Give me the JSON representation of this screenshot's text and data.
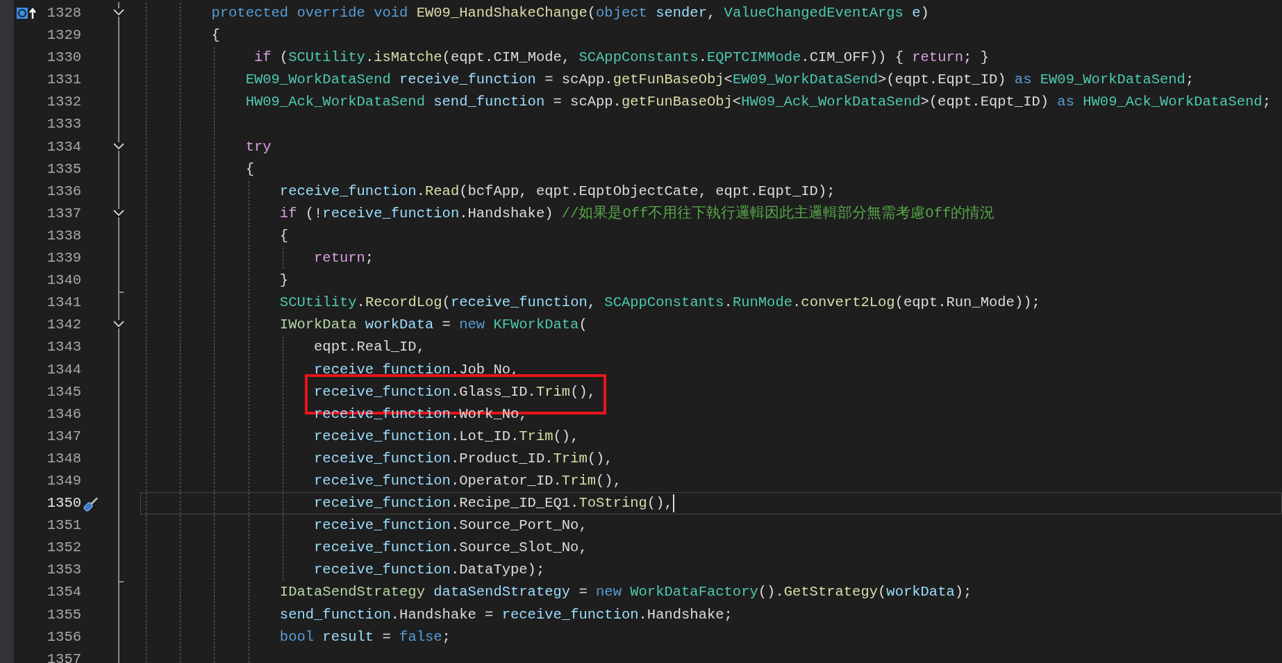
{
  "lines": [
    {
      "number": "1328",
      "collapsible": true,
      "block_end": false,
      "current": false,
      "highlighted": false,
      "glyph": {
        "kind": "override"
      },
      "code": [
        {
          "kind": "keyword",
          "text": "        protected override void "
        },
        {
          "kind": "method",
          "text": "EW09_HandShakeChange"
        },
        {
          "kind": "plain",
          "text": "("
        },
        {
          "kind": "keyword",
          "text": "object"
        },
        {
          "kind": "local",
          "text": " sender"
        },
        {
          "kind": "plain",
          "text": ", "
        },
        {
          "kind": "type",
          "text": "ValueChangedEventArgs"
        },
        {
          "kind": "local",
          "text": " e"
        },
        {
          "kind": "plain",
          "text": ")"
        }
      ]
    },
    {
      "number": "1329",
      "collapsible": false,
      "block_end": false,
      "current": false,
      "highlighted": false,
      "code": [
        {
          "kind": "plain",
          "text": "        {"
        }
      ]
    },
    {
      "number": "1330",
      "collapsible": false,
      "block_end": false,
      "current": false,
      "highlighted": false,
      "code": [
        {
          "kind": "control",
          "text": "             if"
        },
        {
          "kind": "plain",
          "text": " ("
        },
        {
          "kind": "type",
          "text": "SCUtility"
        },
        {
          "kind": "plain",
          "text": "."
        },
        {
          "kind": "method",
          "text": "isMatche"
        },
        {
          "kind": "plain",
          "text": "(eqpt.CIM_Mode, "
        },
        {
          "kind": "type",
          "text": "SCAppConstants"
        },
        {
          "kind": "plain",
          "text": "."
        },
        {
          "kind": "type",
          "text": "EQPTCIMMode"
        },
        {
          "kind": "plain",
          "text": ".CIM_OFF)) { "
        },
        {
          "kind": "control",
          "text": "return"
        },
        {
          "kind": "plain",
          "text": "; }"
        }
      ]
    },
    {
      "number": "1331",
      "collapsible": false,
      "block_end": false,
      "current": false,
      "highlighted": false,
      "code": [
        {
          "kind": "type",
          "text": "            EW09_WorkDataSend"
        },
        {
          "kind": "local",
          "text": " receive_function"
        },
        {
          "kind": "plain",
          "text": " = scApp."
        },
        {
          "kind": "method",
          "text": "getFunBaseObj"
        },
        {
          "kind": "plain",
          "text": "<"
        },
        {
          "kind": "type",
          "text": "EW09_WorkDataSend"
        },
        {
          "kind": "plain",
          "text": ">(eqpt.Eqpt_ID) "
        },
        {
          "kind": "keyword",
          "text": "as"
        },
        {
          "kind": "type",
          "text": " EW09_WorkDataSend"
        },
        {
          "kind": "plain",
          "text": ";"
        }
      ]
    },
    {
      "number": "1332",
      "collapsible": false,
      "block_end": false,
      "current": false,
      "highlighted": false,
      "code": [
        {
          "kind": "type",
          "text": "            HW09_Ack_WorkDataSend"
        },
        {
          "kind": "local",
          "text": " send_function"
        },
        {
          "kind": "plain",
          "text": " = scApp."
        },
        {
          "kind": "method",
          "text": "getFunBaseObj"
        },
        {
          "kind": "plain",
          "text": "<"
        },
        {
          "kind": "type",
          "text": "HW09_Ack_WorkDataSend"
        },
        {
          "kind": "plain",
          "text": ">(eqpt.Eqpt_ID) "
        },
        {
          "kind": "keyword",
          "text": "as"
        },
        {
          "kind": "type",
          "text": " HW09_Ack_WorkDataSend"
        },
        {
          "kind": "plain",
          "text": ";"
        }
      ]
    },
    {
      "number": "1333",
      "collapsible": false,
      "block_end": false,
      "current": false,
      "highlighted": false
    },
    {
      "number": "1334",
      "collapsible": true,
      "block_end": false,
      "current": false,
      "highlighted": false,
      "code": [
        {
          "kind": "control",
          "text": "            try"
        }
      ]
    },
    {
      "number": "1335",
      "collapsible": false,
      "block_end": false,
      "current": false,
      "highlighted": false,
      "code": [
        {
          "kind": "plain",
          "text": "            {"
        }
      ]
    },
    {
      "number": "1336",
      "collapsible": false,
      "block_end": false,
      "current": false,
      "highlighted": false,
      "code": [
        {
          "kind": "local",
          "text": "                receive_function"
        },
        {
          "kind": "plain",
          "text": "."
        },
        {
          "kind": "method",
          "text": "Read"
        },
        {
          "kind": "plain",
          "text": "(bcfApp, eqpt.EqptObjectCate, eqpt.Eqpt_ID);"
        }
      ]
    },
    {
      "number": "1337",
      "collapsible": true,
      "block_end": false,
      "current": false,
      "highlighted": false,
      "code": [
        {
          "kind": "control",
          "text": "                if"
        },
        {
          "kind": "plain",
          "text": " (!"
        },
        {
          "kind": "local",
          "text": "receive_function"
        },
        {
          "kind": "plain",
          "text": ".Handshake) "
        },
        {
          "kind": "comment",
          "text": "//如果是Off不用往下執行邏輯因此主邏輯部分無需考慮Off的情況"
        }
      ]
    },
    {
      "number": "1338",
      "collapsible": false,
      "block_end": false,
      "current": false,
      "highlighted": false,
      "code": [
        {
          "kind": "plain",
          "text": "                {"
        }
      ]
    },
    {
      "number": "1339",
      "collapsible": false,
      "block_end": false,
      "current": false,
      "highlighted": false,
      "code": [
        {
          "kind": "control",
          "text": "                    return"
        },
        {
          "kind": "plain",
          "text": ";"
        }
      ]
    },
    {
      "number": "1340",
      "collapsible": false,
      "block_end": false,
      "current": false,
      "highlighted": false,
      "code": [
        {
          "kind": "plain",
          "text": "                }"
        }
      ]
    },
    {
      "number": "1341",
      "collapsible": false,
      "block_end": true,
      "current": false,
      "highlighted": false,
      "code": [
        {
          "kind": "type",
          "text": "                SCUtility"
        },
        {
          "kind": "plain",
          "text": "."
        },
        {
          "kind": "method",
          "text": "RecordLog"
        },
        {
          "kind": "plain",
          "text": "("
        },
        {
          "kind": "local",
          "text": "receive_function"
        },
        {
          "kind": "plain",
          "text": ", "
        },
        {
          "kind": "type",
          "text": "SCAppConstants"
        },
        {
          "kind": "plain",
          "text": "."
        },
        {
          "kind": "type",
          "text": "RunMode"
        },
        {
          "kind": "plain",
          "text": "."
        },
        {
          "kind": "method",
          "text": "convert2Log"
        },
        {
          "kind": "plain",
          "text": "(eqpt.Run_Mode));"
        }
      ]
    },
    {
      "number": "1342",
      "collapsible": true,
      "block_end": false,
      "current": false,
      "highlighted": false,
      "code": [
        {
          "kind": "interface",
          "text": "                IWorkData"
        },
        {
          "kind": "local",
          "text": " workData"
        },
        {
          "kind": "plain",
          "text": " = "
        },
        {
          "kind": "keyword",
          "text": "new"
        },
        {
          "kind": "type",
          "text": " KFWorkData"
        },
        {
          "kind": "plain",
          "text": "("
        }
      ]
    },
    {
      "number": "1343",
      "collapsible": false,
      "block_end": false,
      "current": false,
      "highlighted": false,
      "code": [
        {
          "kind": "plain",
          "text": "                    eqpt.Real_ID,"
        }
      ]
    },
    {
      "number": "1344",
      "collapsible": false,
      "block_end": false,
      "current": false,
      "highlighted": false,
      "code": [
        {
          "kind": "local",
          "text": "                    receive_function"
        },
        {
          "kind": "plain",
          "text": ".Job_No,"
        }
      ]
    },
    {
      "number": "1345",
      "collapsible": false,
      "block_end": false,
      "current": false,
      "highlighted": true,
      "code": [
        {
          "kind": "local",
          "text": "                    receive_function"
        },
        {
          "kind": "plain",
          "text": ".Glass_ID."
        },
        {
          "kind": "method",
          "text": "Trim"
        },
        {
          "kind": "plain",
          "text": "(),"
        }
      ]
    },
    {
      "number": "1346",
      "collapsible": false,
      "block_end": false,
      "current": false,
      "highlighted": false,
      "code": [
        {
          "kind": "local",
          "text": "                    receive_function"
        },
        {
          "kind": "plain",
          "text": ".Work_No,"
        }
      ]
    },
    {
      "number": "1347",
      "collapsible": false,
      "block_end": false,
      "current": false,
      "highlighted": false,
      "code": [
        {
          "kind": "local",
          "text": "                    receive_function"
        },
        {
          "kind": "plain",
          "text": ".Lot_ID."
        },
        {
          "kind": "method",
          "text": "Trim"
        },
        {
          "kind": "plain",
          "text": "(),"
        }
      ]
    },
    {
      "number": "1348",
      "collapsible": false,
      "block_end": false,
      "current": false,
      "highlighted": false,
      "code": [
        {
          "kind": "local",
          "text": "                    receive_function"
        },
        {
          "kind": "plain",
          "text": ".Product_ID."
        },
        {
          "kind": "method",
          "text": "Trim"
        },
        {
          "kind": "plain",
          "text": "(),"
        }
      ]
    },
    {
      "number": "1349",
      "collapsible": false,
      "block_end": false,
      "current": false,
      "highlighted": false,
      "code": [
        {
          "kind": "local",
          "text": "                    receive_function"
        },
        {
          "kind": "plain",
          "text": ".Operator_ID."
        },
        {
          "kind": "method",
          "text": "Trim"
        },
        {
          "kind": "plain",
          "text": "(),"
        }
      ]
    },
    {
      "number": "1350",
      "collapsible": false,
      "block_end": false,
      "current": true,
      "highlighted": false,
      "glyph": {
        "kind": "quick-action"
      },
      "code": [
        {
          "kind": "local",
          "text": "                    receive_function"
        },
        {
          "kind": "plain",
          "text": ".Recipe_ID_EQ1."
        },
        {
          "kind": "method",
          "text": "ToString"
        },
        {
          "kind": "plain",
          "text": "(),"
        }
      ]
    },
    {
      "number": "1351",
      "collapsible": false,
      "block_end": false,
      "current": false,
      "highlighted": false,
      "code": [
        {
          "kind": "local",
          "text": "                    receive_function"
        },
        {
          "kind": "plain",
          "text": ".Source_Port_No,"
        }
      ]
    },
    {
      "number": "1352",
      "collapsible": false,
      "block_end": false,
      "current": false,
      "highlighted": false,
      "code": [
        {
          "kind": "local",
          "text": "                    receive_function"
        },
        {
          "kind": "plain",
          "text": ".Source_Slot_No,"
        }
      ]
    },
    {
      "number": "1353",
      "collapsible": false,
      "block_end": false,
      "current": false,
      "highlighted": false,
      "code": [
        {
          "kind": "local",
          "text": "                    receive_function"
        },
        {
          "kind": "plain",
          "text": ".DataType);"
        }
      ]
    },
    {
      "number": "1354",
      "collapsible": false,
      "block_end": true,
      "current": false,
      "highlighted": false,
      "code": [
        {
          "kind": "interface",
          "text": "                IDataSendStrategy"
        },
        {
          "kind": "local",
          "text": " dataSendStrategy"
        },
        {
          "kind": "plain",
          "text": " = "
        },
        {
          "kind": "keyword",
          "text": "new"
        },
        {
          "kind": "type",
          "text": " WorkDataFactory"
        },
        {
          "kind": "plain",
          "text": "()."
        },
        {
          "kind": "method",
          "text": "GetStrategy"
        },
        {
          "kind": "plain",
          "text": "("
        },
        {
          "kind": "local",
          "text": "workData"
        },
        {
          "kind": "plain",
          "text": ");"
        }
      ]
    },
    {
      "number": "1355",
      "collapsible": false,
      "block_end": false,
      "current": false,
      "highlighted": false,
      "code": [
        {
          "kind": "local",
          "text": "                send_function"
        },
        {
          "kind": "plain",
          "text": ".Handshake = "
        },
        {
          "kind": "local",
          "text": "receive_function"
        },
        {
          "kind": "plain",
          "text": ".Handshake;"
        }
      ]
    },
    {
      "number": "1356",
      "collapsible": false,
      "block_end": false,
      "current": false,
      "highlighted": false,
      "code": [
        {
          "kind": "keyword",
          "text": "                bool"
        },
        {
          "kind": "local",
          "text": " result"
        },
        {
          "kind": "plain",
          "text": " = "
        },
        {
          "kind": "keyword",
          "text": "false"
        },
        {
          "kind": "plain",
          "text": ";"
        }
      ]
    },
    {
      "number": "1357",
      "collapsible": false,
      "block_end": false,
      "current": false,
      "highlighted": false
    }
  ]
}
